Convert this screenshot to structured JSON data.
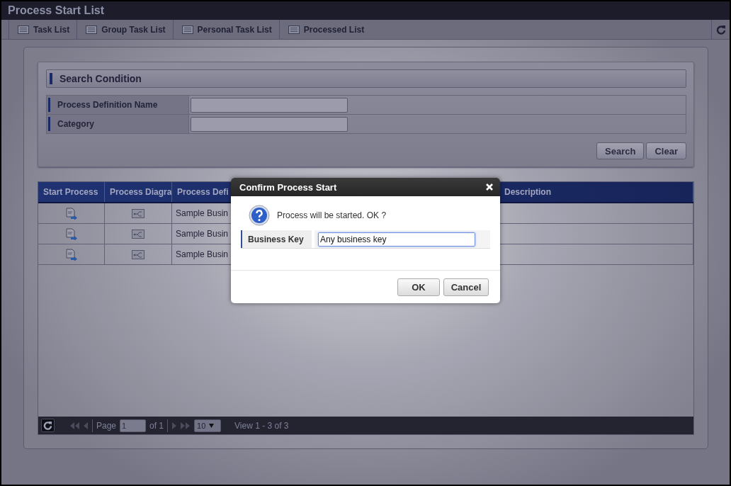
{
  "window": {
    "title": "Process Start List"
  },
  "toolbar": {
    "tabs": [
      {
        "label": "Task List"
      },
      {
        "label": "Group Task List"
      },
      {
        "label": "Personal Task List"
      },
      {
        "label": "Processed List"
      }
    ]
  },
  "search": {
    "title": "Search Condition",
    "fields": [
      {
        "label": "Process Definition Name"
      },
      {
        "label": "Category"
      }
    ],
    "buttons": [
      "Search",
      "Clear"
    ]
  },
  "table": {
    "columns": [
      "Start Process",
      "Process Diagra",
      "Process Defi",
      "Description"
    ],
    "rows": [
      {
        "process_definition": "Sample Busin"
      },
      {
        "process_definition": "Sample Busin"
      },
      {
        "process_definition": "Sample Busin"
      }
    ]
  },
  "pager": {
    "page_label": "Page",
    "page": "1",
    "of": "of 1",
    "page_size": "10",
    "view": "View 1 - 3 of 3"
  },
  "dialog": {
    "title": "Confirm Process Start",
    "message": "Process will be started. OK ?",
    "field": {
      "label": "Business Key",
      "value": "Any business key"
    },
    "buttons": [
      "OK",
      "Cancel"
    ]
  }
}
